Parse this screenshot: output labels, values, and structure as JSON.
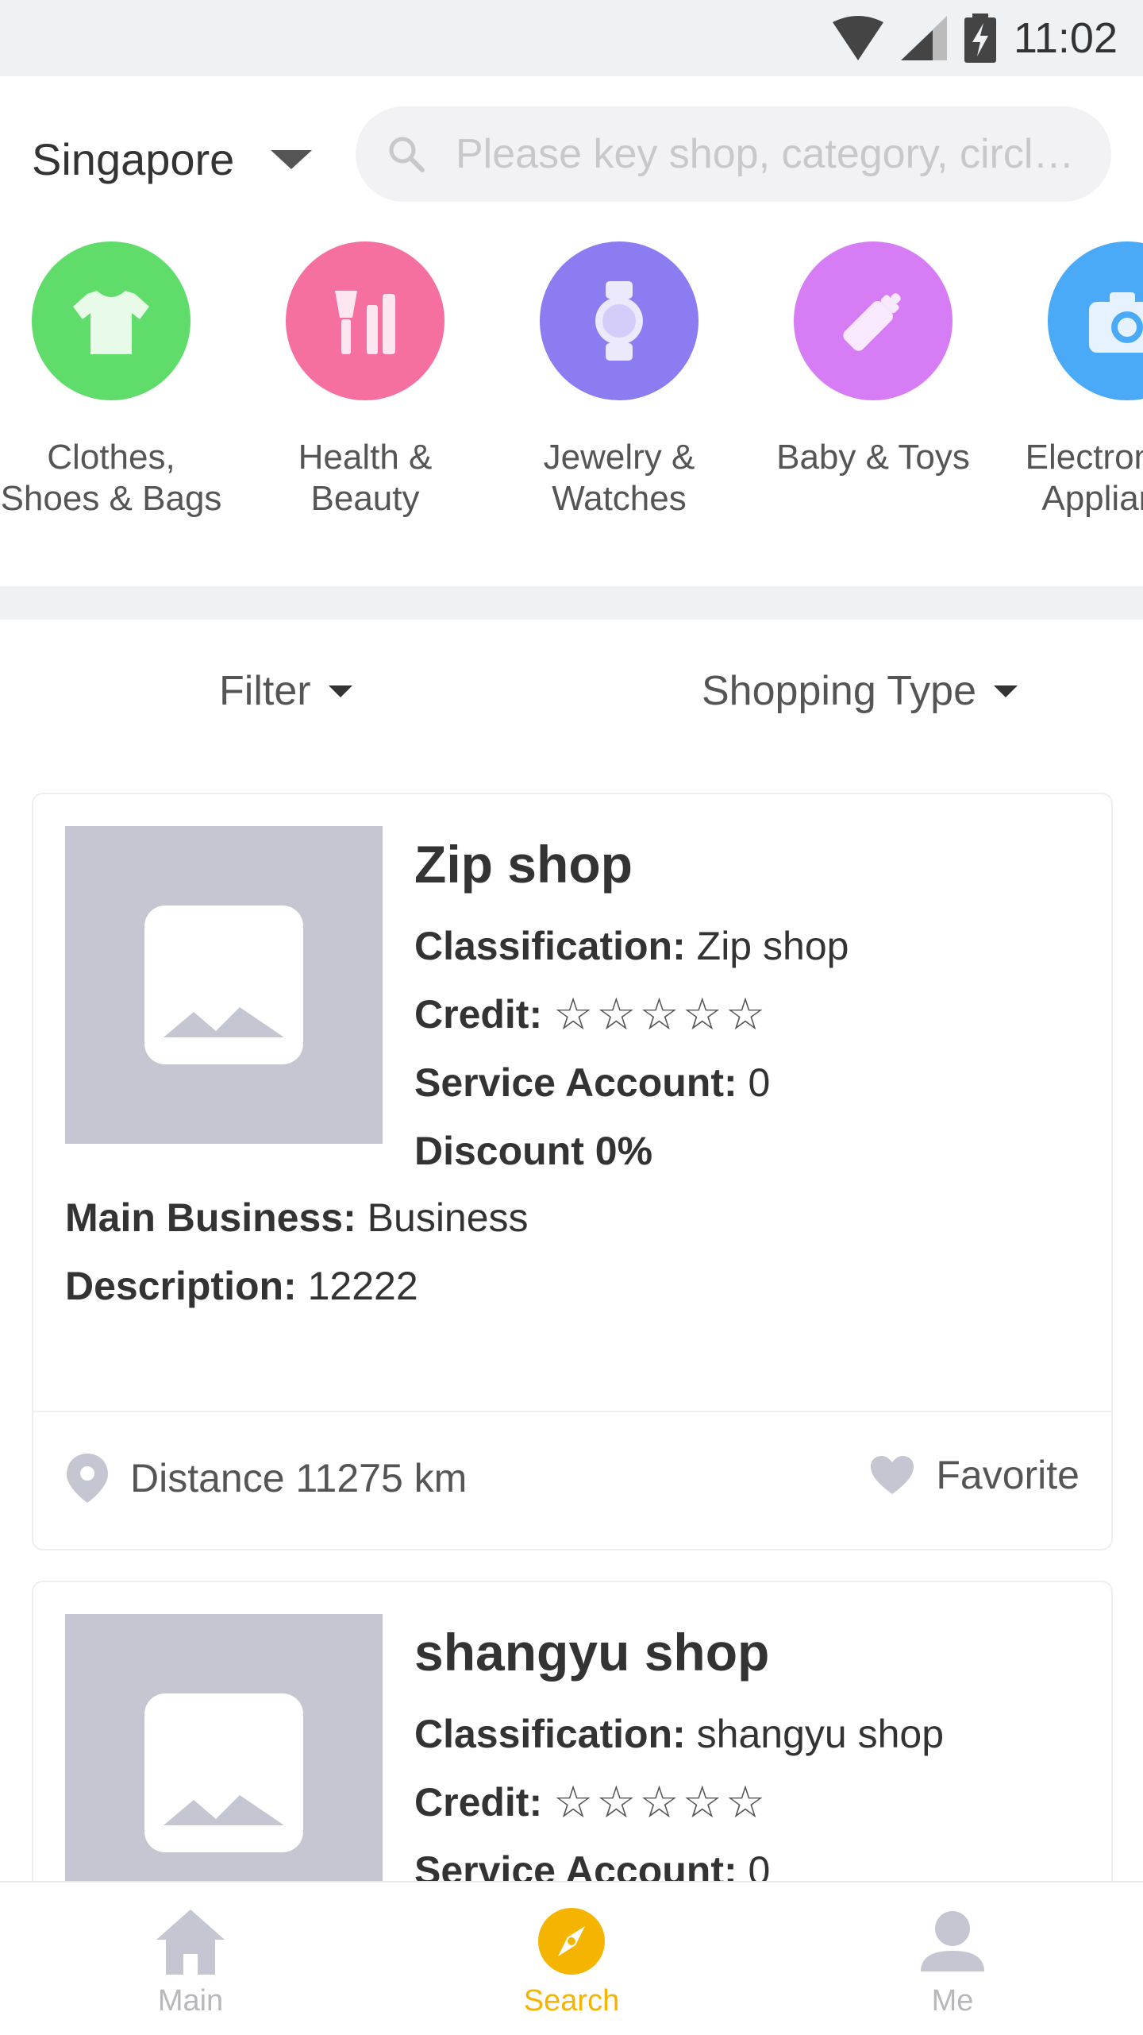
{
  "status_bar": {
    "time": "11:02"
  },
  "header": {
    "location": "Singapore",
    "search_placeholder": "Please key shop, category, circle..."
  },
  "categories": [
    {
      "label": "Clothes,\nShoes & Bags",
      "icon": "tshirt-icon",
      "color": "#5fdc6a"
    },
    {
      "label": "Health &\nBeauty",
      "icon": "cosmetics-icon",
      "color": "#f56fa1"
    },
    {
      "label": "Jewelry &\nWatches",
      "icon": "watch-icon",
      "color": "#8b7cf2"
    },
    {
      "label": "Baby & Toys",
      "icon": "baby-bottle-icon",
      "color": "#d67cf5"
    },
    {
      "label": "Electronics &\nAppliances",
      "icon": "camera-icon",
      "color": "#4aaaf7"
    }
  ],
  "filters": {
    "filter": "Filter",
    "shopping_type": "Shopping Type"
  },
  "shops": [
    {
      "name": "Zip shop",
      "classification_label": "Classification:",
      "classification": "Zip shop",
      "credit_label": "Credit:",
      "credit_stars": "☆☆☆☆☆",
      "service_label": "Service Account:",
      "service_account": "0",
      "discount": "Discount 0%",
      "main_business_label": "Main Business:",
      "main_business": "Business",
      "description_label": "Description:",
      "description": "12222",
      "distance": "Distance 11275 km",
      "favorite": "Favorite"
    },
    {
      "name": "shangyu shop",
      "classification_label": "Classification:",
      "classification": "shangyu shop",
      "credit_label": "Credit:",
      "credit_stars": "☆☆☆☆☆",
      "service_label": "Service Account:",
      "service_account": "0"
    }
  ],
  "nav": {
    "main": "Main",
    "search": "Search",
    "me": "Me",
    "active_color": "#f5b400",
    "inactive_color": "#b8b8bc"
  }
}
